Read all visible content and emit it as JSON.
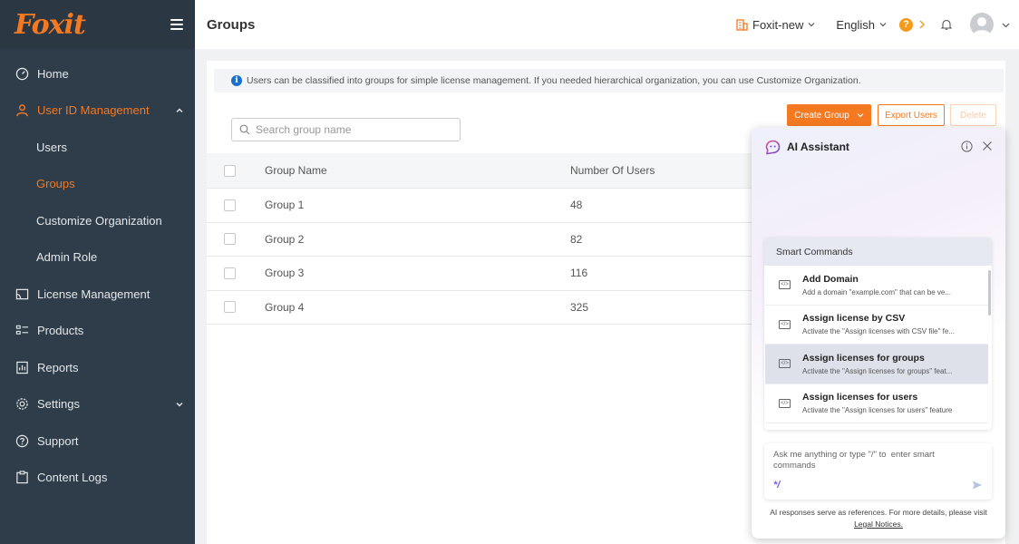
{
  "brand": {
    "logo_text": "Foxit",
    "accent": "#f47920"
  },
  "sidebar": {
    "items": [
      {
        "label": "Home",
        "icon": "dashboard-icon"
      },
      {
        "label": "User ID Management",
        "icon": "user-icon"
      },
      {
        "label": "Users"
      },
      {
        "label": "Groups"
      },
      {
        "label": "Customize Organization"
      },
      {
        "label": "Admin Role"
      },
      {
        "label": "License Management",
        "icon": "license-icon"
      },
      {
        "label": "Products",
        "icon": "products-icon"
      },
      {
        "label": "Reports",
        "icon": "reports-icon"
      },
      {
        "label": "Settings",
        "icon": "settings-icon"
      },
      {
        "label": "Support",
        "icon": "support-icon"
      },
      {
        "label": "Content Logs",
        "icon": "content-logs-icon"
      }
    ]
  },
  "header": {
    "title": "Groups",
    "tenant": "Foxit-new",
    "language": "English",
    "help_label": "?"
  },
  "main": {
    "info_text": "Users can be classified into groups for simple license management. If you needed hierarchical organization, you can use Customize Organization.",
    "buttons": {
      "create": "Create Group",
      "export": "Export Users",
      "delete": "Delete"
    },
    "search": {
      "placeholder": "Search group name",
      "value": ""
    },
    "table": {
      "columns": [
        "Group Name",
        "Number Of Users"
      ],
      "rows": [
        {
          "name": "Group 1",
          "users": "48"
        },
        {
          "name": "Group 2",
          "users": "82"
        },
        {
          "name": "Group 3",
          "users": "116"
        },
        {
          "name": "Group 4",
          "users": "325"
        }
      ]
    }
  },
  "ai": {
    "title": "AI Assistant",
    "smart_commands_label": "Smart Commands",
    "commands": [
      {
        "title": "Add Domain",
        "desc": "Add a domain \"example.com\" that can be ve..."
      },
      {
        "title": "Assign license by CSV",
        "desc": "Activate the \"Assign licenses with CSV file\" fe..."
      },
      {
        "title": "Assign licenses for groups",
        "desc": "Activate the \"Assign licenses for groups\" feat..."
      },
      {
        "title": "Assign licenses for users",
        "desc": "Activate the \"Assign licenses for users\" feature"
      }
    ],
    "input_placeholder": "Ask me anything or type \"/\" to  enter smart commands",
    "slash_label": "*/",
    "footer_text": "AI responses serve as references. For more details, please visit",
    "footer_link": "Legal Notices."
  }
}
